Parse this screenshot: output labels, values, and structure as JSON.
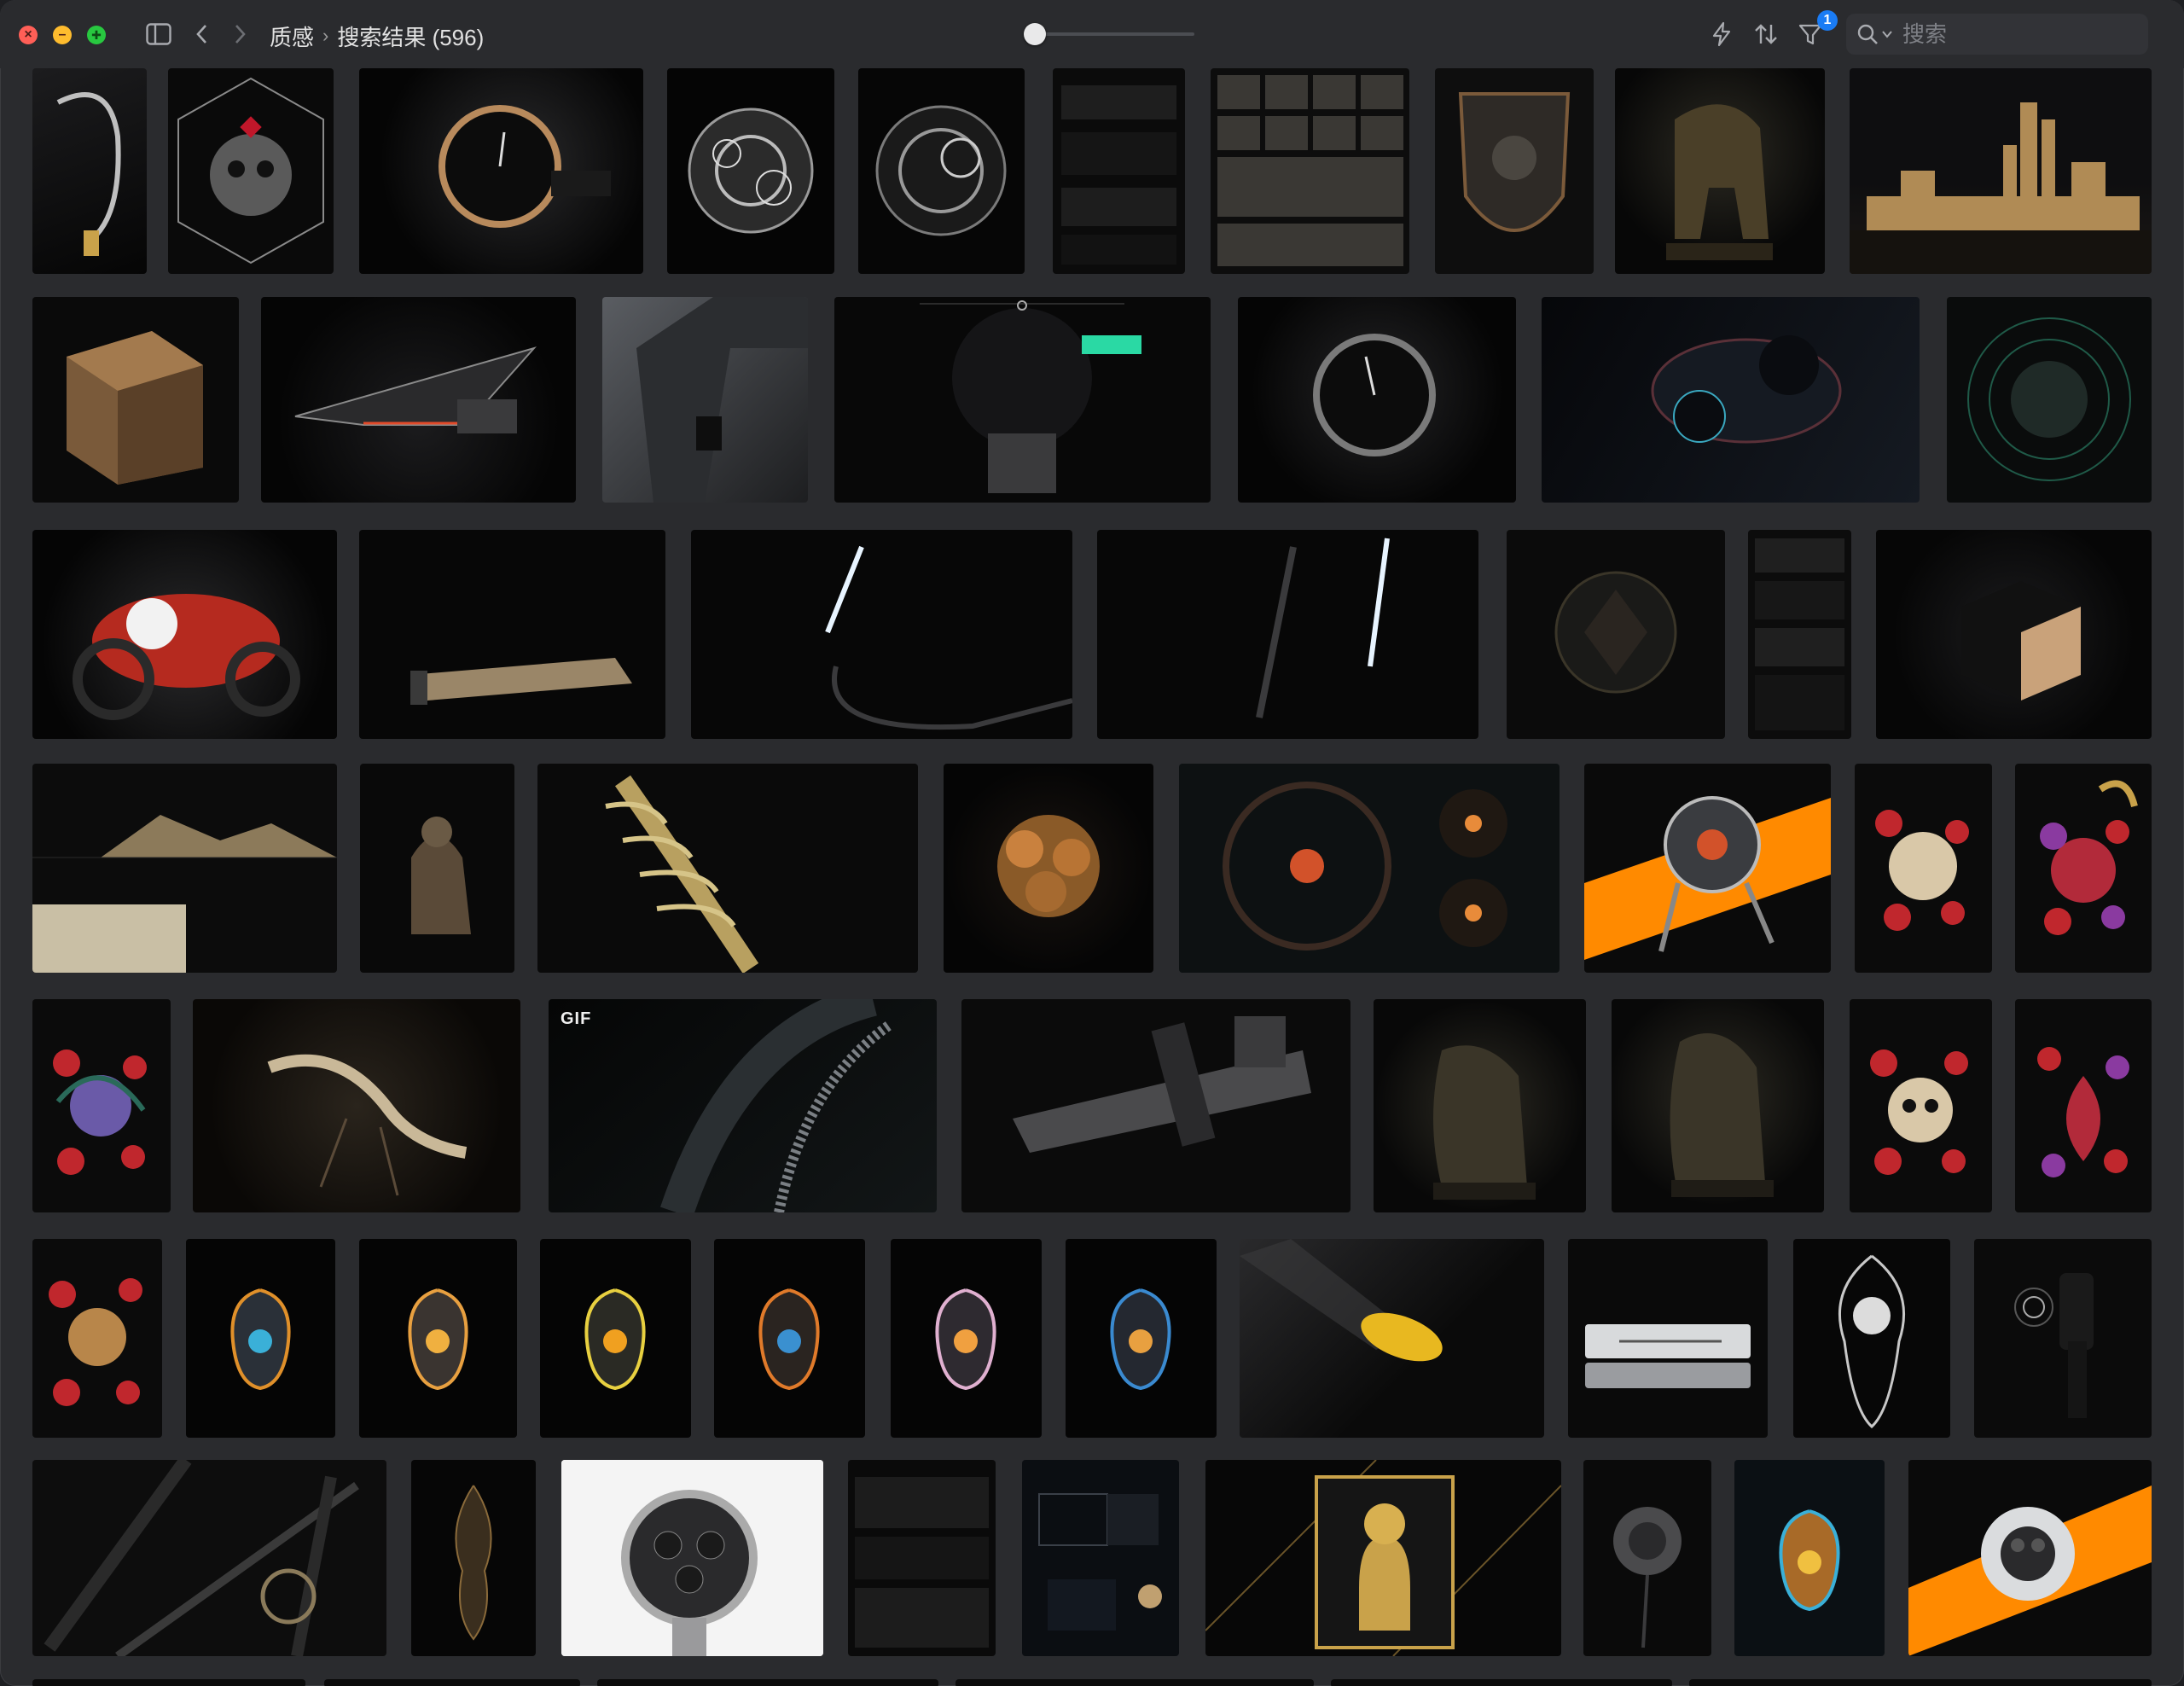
{
  "window": {
    "breadcrumb": {
      "root": "质感",
      "separator": "›",
      "current": "搜索结果 (596)"
    },
    "filter_badge": "1",
    "search": {
      "placeholder": "搜索",
      "value": ""
    },
    "zoom_level": 0.0
  },
  "icons": {
    "close": "close-icon",
    "minimize": "minimize-icon",
    "maximize": "maximize-icon",
    "sidebar": "sidebar-toggle-icon",
    "back": "chevron-left-icon",
    "forward": "chevron-right-icon",
    "bolt": "bolt-icon",
    "sort": "sort-icon",
    "filter": "filter-icon",
    "search": "search-icon"
  },
  "thumbnails": [
    {
      "label": ""
    },
    {
      "label": ""
    },
    {
      "label": ""
    },
    {
      "label": ""
    },
    {
      "label": ""
    },
    {
      "label": ""
    },
    {
      "label": ""
    },
    {
      "label": ""
    },
    {
      "label": ""
    },
    {
      "label": ""
    },
    {
      "label": ""
    },
    {
      "label": ""
    },
    {
      "label": ""
    },
    {
      "label": ""
    },
    {
      "label": ""
    },
    {
      "label": ""
    },
    {
      "label": ""
    },
    {
      "label": ""
    },
    {
      "label": ""
    },
    {
      "label": ""
    },
    {
      "label": ""
    },
    {
      "label": ""
    },
    {
      "label": ""
    },
    {
      "label": ""
    },
    {
      "label": ""
    },
    {
      "label": ""
    },
    {
      "label": ""
    },
    {
      "label": ""
    },
    {
      "label": ""
    },
    {
      "label": ""
    },
    {
      "label": ""
    },
    {
      "label": ""
    },
    {
      "label": ""
    },
    {
      "label": ""
    },
    {
      "label": "GIF"
    },
    {
      "label": ""
    },
    {
      "label": ""
    },
    {
      "label": ""
    },
    {
      "label": ""
    },
    {
      "label": ""
    },
    {
      "label": ""
    },
    {
      "label": ""
    },
    {
      "label": ""
    },
    {
      "label": ""
    },
    {
      "label": ""
    },
    {
      "label": ""
    },
    {
      "label": ""
    },
    {
      "label": ""
    },
    {
      "label": ""
    },
    {
      "label": ""
    },
    {
      "label": ""
    },
    {
      "label": ""
    },
    {
      "label": ""
    },
    {
      "label": ""
    },
    {
      "label": ""
    },
    {
      "label": ""
    },
    {
      "label": ""
    },
    {
      "label": ""
    },
    {
      "label": ""
    },
    {
      "label": ""
    }
  ],
  "colors": {
    "window_bg": "#2a2b2e",
    "thumb_bg": "#0b0b0c",
    "accent_orange": "#ff8a00",
    "accent_gold": "#c9a24a",
    "badge_blue": "#1a7cf5"
  }
}
